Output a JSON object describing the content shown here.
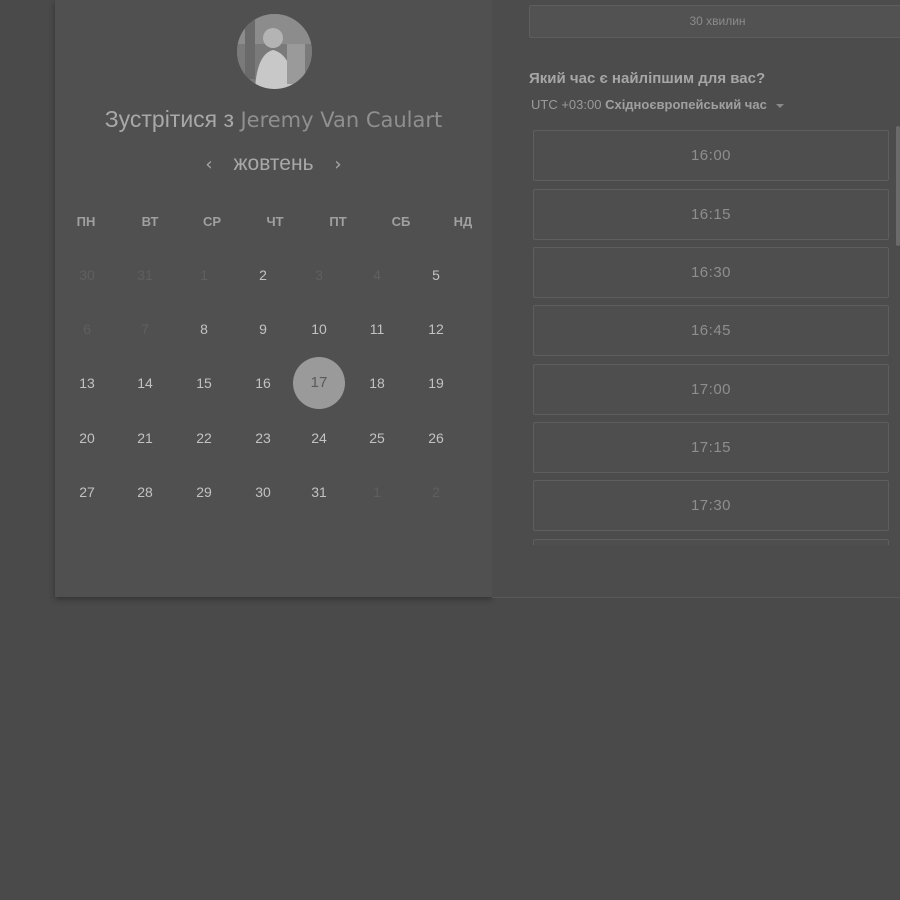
{
  "host": {
    "prefix": "Зустрітися з",
    "name": "Jeremy Van Caulart"
  },
  "calendar": {
    "month": "жовтень",
    "prev_icon": "chevron-left-icon",
    "next_icon": "chevron-right-icon",
    "weekdays": [
      "ПН",
      "ВТ",
      "СР",
      "ЧТ",
      "ПТ",
      "СБ",
      "НД"
    ],
    "weeks": [
      [
        "30",
        "31",
        "1",
        "2",
        "3",
        "4",
        "5"
      ],
      [
        "6",
        "7",
        "8",
        "9",
        "10",
        "11",
        "12"
      ],
      [
        "13",
        "14",
        "15",
        "16",
        "17",
        "18",
        "19"
      ],
      [
        "20",
        "21",
        "22",
        "23",
        "24",
        "25",
        "26"
      ],
      [
        "27",
        "28",
        "29",
        "30",
        "31",
        "1",
        "2"
      ]
    ],
    "selected_day": "17"
  },
  "booking": {
    "duration": "30 хвилин",
    "question": "Який час є найліпшим для вас?",
    "timezone_offset": "UTC +03:00",
    "timezone_name": "Східноєвропейський час",
    "slots": [
      "16:00",
      "16:15",
      "16:30",
      "16:45",
      "17:00",
      "17:15",
      "17:30"
    ]
  },
  "colors": {
    "selected_day_bg": "#9a9a9a",
    "page_bg": "#4a4a4a"
  }
}
